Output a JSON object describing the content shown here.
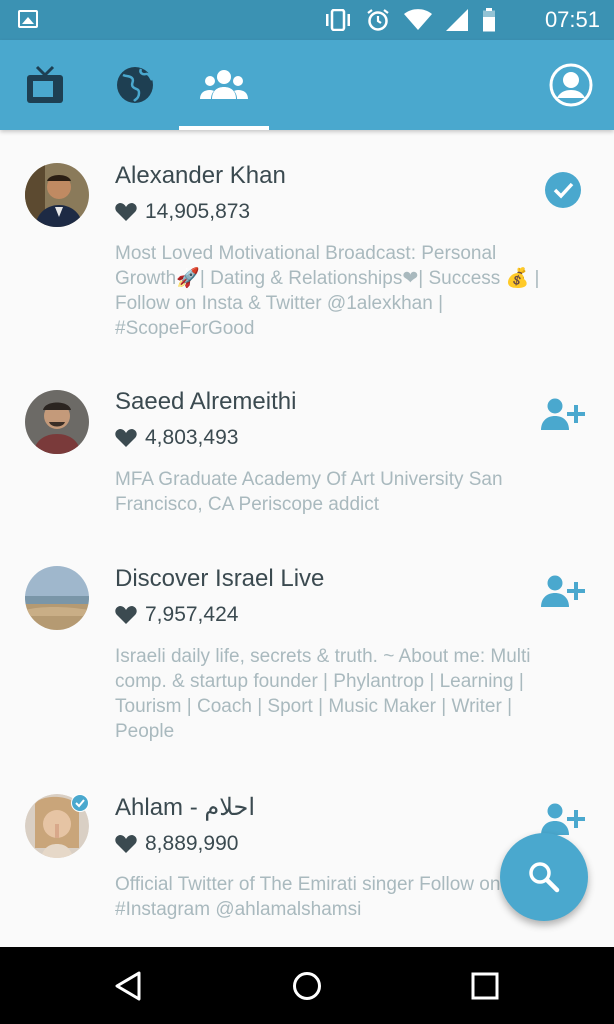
{
  "status_bar": {
    "time": "07:51",
    "icons": [
      "image-icon",
      "vibrate-icon",
      "alarm-icon",
      "wifi-icon",
      "signal-icon",
      "battery-icon"
    ]
  },
  "app_bar": {
    "tabs": [
      {
        "name": "tv-icon",
        "selected": false
      },
      {
        "name": "globe-icon",
        "selected": false
      },
      {
        "name": "people-icon",
        "selected": true
      }
    ],
    "profile_icon": "account-icon"
  },
  "colors": {
    "accent": "#4aa8ce",
    "status_bar": "#3b92b3",
    "name_text": "#3b4a50",
    "desc_text": "#a9b9be"
  },
  "users": [
    {
      "name": "Alexander Khan",
      "hearts": "14,905,873",
      "description": "Most Loved Motivational Broadcast: Personal Growth🚀| Dating & Relationships❤| Success 💰 | Follow on Insta & Twitter @1alexkhan | #ScopeForGood",
      "action": "following-check-icon",
      "verified": false
    },
    {
      "name": "Saeed Alremeithi",
      "hearts": "4,803,493",
      "description": "MFA Graduate Academy Of Art  University San Francisco, CA Periscope addict",
      "action": "follow-add-icon",
      "verified": false
    },
    {
      "name": "Discover Israel Live",
      "hearts": "7,957,424",
      "description": "Israeli daily life, secrets & truth. ~ About me: Multi comp. & startup founder | Phylantrop | Learning | Tourism | Coach | Sport | Music Maker | Writer | People",
      "action": "follow-add-icon",
      "verified": false
    },
    {
      "name": "Ahlam - احلام",
      "hearts": "8,889,990",
      "description": "Official Twitter of The Emirati singer Follow on #Instagram @ahlamalshamsi",
      "action": "follow-add-icon",
      "verified": true
    }
  ],
  "fab": {
    "icon": "search-icon"
  },
  "nav_bar": {
    "buttons": [
      "back-icon",
      "home-icon",
      "recents-icon"
    ]
  }
}
